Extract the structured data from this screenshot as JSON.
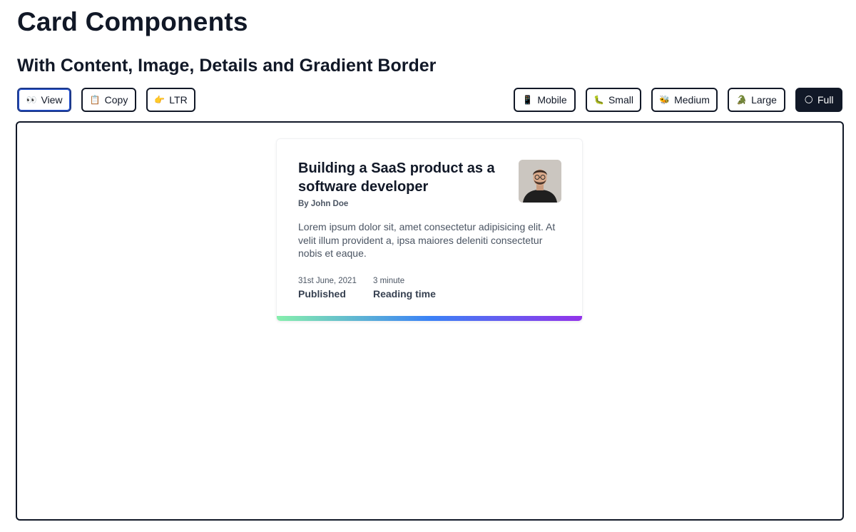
{
  "page": {
    "title": "Card Components",
    "section_title": "With Content, Image, Details and Gradient Border"
  },
  "toolbar": {
    "left": [
      {
        "icon": "👀",
        "icon_name": "eyes-icon",
        "label": "View"
      },
      {
        "icon": "📋",
        "icon_name": "clipboard-icon",
        "label": "Copy"
      },
      {
        "icon": "👉",
        "icon_name": "pointing-right-icon",
        "label": "LTR"
      }
    ],
    "right": [
      {
        "icon": "📱",
        "icon_name": "mobile-phone-icon",
        "label": "Mobile"
      },
      {
        "icon": "🐛",
        "icon_name": "bug-icon",
        "label": "Small"
      },
      {
        "icon": "🐝",
        "icon_name": "bee-icon",
        "label": "Medium"
      },
      {
        "icon": "🐊",
        "icon_name": "crocodile-icon",
        "label": "Large"
      },
      {
        "icon": "🌕",
        "icon_name": "full-moon-icon",
        "label": "Full"
      }
    ]
  },
  "card": {
    "title": "Building a SaaS product as a software developer",
    "author": "By John Doe",
    "body": "Lorem ipsum dolor sit, amet consectetur adipisicing elit. At velit illum provident a, ipsa maiores deleniti consectetur nobis et eaque.",
    "details": [
      {
        "value": "31st June, 2021",
        "label": "Published"
      },
      {
        "value": "3 minute",
        "label": "Reading time"
      }
    ],
    "gradient_colors": [
      "#86efac",
      "#3b82f6",
      "#9333ea"
    ]
  }
}
